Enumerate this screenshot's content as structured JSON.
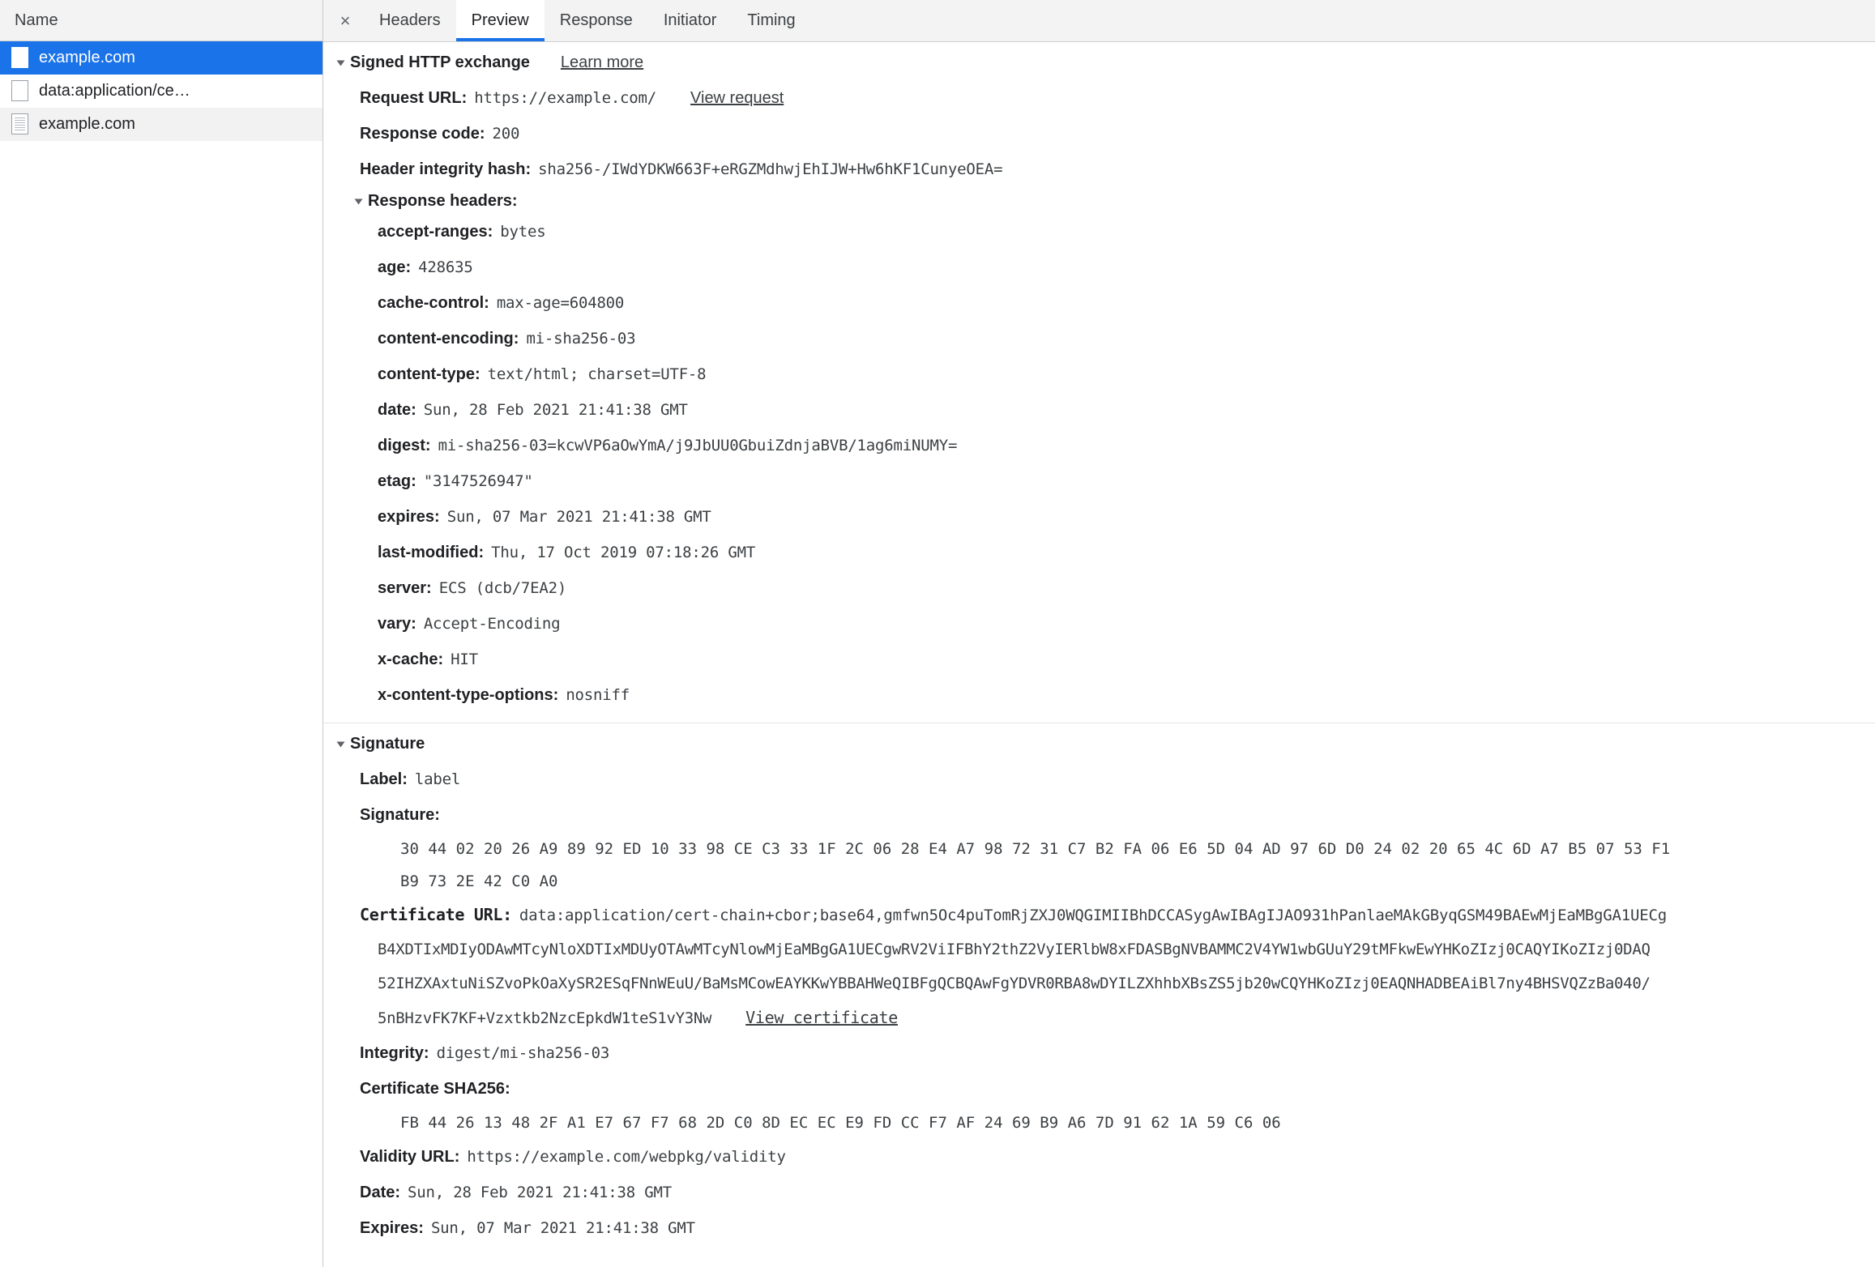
{
  "request_list": {
    "column_header": "Name",
    "items": [
      {
        "label": "example.com",
        "icon": "document-icon",
        "selected": true,
        "striped": false,
        "lined": false
      },
      {
        "label": "data:application/ce…",
        "icon": "document-icon",
        "selected": false,
        "striped": false,
        "lined": false
      },
      {
        "label": "example.com",
        "icon": "document-icon",
        "selected": false,
        "striped": true,
        "lined": true
      }
    ]
  },
  "tabs": {
    "close_label": "×",
    "items": [
      {
        "label": "Headers",
        "active": false
      },
      {
        "label": "Preview",
        "active": true
      },
      {
        "label": "Response",
        "active": false
      },
      {
        "label": "Initiator",
        "active": false
      },
      {
        "label": "Timing",
        "active": false
      }
    ]
  },
  "sxg": {
    "title": "Signed HTTP exchange",
    "learn_more": "Learn more",
    "request_url_key": "Request URL:",
    "request_url_value": "https://example.com/",
    "view_request": "View request",
    "response_code_key": "Response code:",
    "response_code_value": "200",
    "header_integrity_key": "Header integrity hash:",
    "header_integrity_value": "sha256-/IWdYDKW663F+eRGZMdhwjEhIJW+Hw6hKF1CunyeOEA=",
    "response_headers_title": "Response headers:",
    "response_headers": [
      {
        "name": "accept-ranges:",
        "value": "bytes"
      },
      {
        "name": "age:",
        "value": "428635"
      },
      {
        "name": "cache-control:",
        "value": "max-age=604800"
      },
      {
        "name": "content-encoding:",
        "value": "mi-sha256-03"
      },
      {
        "name": "content-type:",
        "value": "text/html; charset=UTF-8"
      },
      {
        "name": "date:",
        "value": "Sun, 28 Feb 2021 21:41:38 GMT"
      },
      {
        "name": "digest:",
        "value": "mi-sha256-03=kcwVP6aOwYmA/j9JbUU0GbuiZdnjaBVB/1ag6miNUMY="
      },
      {
        "name": "etag:",
        "value": "\"3147526947\""
      },
      {
        "name": "expires:",
        "value": "Sun, 07 Mar 2021 21:41:38 GMT"
      },
      {
        "name": "last-modified:",
        "value": "Thu, 17 Oct 2019 07:18:26 GMT"
      },
      {
        "name": "server:",
        "value": "ECS (dcb/7EA2)"
      },
      {
        "name": "vary:",
        "value": "Accept-Encoding"
      },
      {
        "name": "x-cache:",
        "value": "HIT"
      },
      {
        "name": "x-content-type-options:",
        "value": "nosniff"
      }
    ]
  },
  "signature": {
    "title": "Signature",
    "label_key": "Label:",
    "label_value": "label",
    "signature_key": "Signature:",
    "signature_bytes_line1": "30 44 02 20 26 A9 89 92 ED 10 33 98 CE C3 33 1F 2C 06 28 E4 A7 98 72 31 C7 B2 FA 06 E6 5D 04 AD 97 6D D0 24 02 20 65 4C 6D A7 B5 07 53 F1",
    "signature_bytes_line2": "B9 73 2E 42 C0 A0",
    "certificate_url_key": "Certificate URL:",
    "certificate_url_lines": [
      "data:application/cert-chain+cbor;base64,gmfwn5Oc4puTomRjZXJ0WQGIMIIBhDCCASygAwIBAgIJAO931hPanlaeMAkGByqGSM49BAEwMjEaMBgGA1UECg",
      "B4XDTIxMDIyODAwMTcyNloXDTIxMDUyOTAwMTcyNlowMjEaMBgGA1UECgwRV2ViIFBhY2thZ2VyIERlbW8xFDASBgNVBAMMC2V4YW1wbGUuY29tMFkwEwYHKoZIzj0CAQYIKoZIzj0DAQ",
      "52IHZXAxtuNiSZvoPkOaXySR2ESqFNnWEuU/BaMsMCowEAYKKwYBBAHWeQIBFgQCBQAwFgYDVR0RBA8wDYILZXhhbXBsZS5jb20wCQYHKoZIzj0EAQNHADBEAiBl7ny4BHSVQZzBa040/",
      "5nBHzvFK7KF+Vzxtkb2NzcEpkdW1teS1vY3Nw"
    ],
    "view_certificate": "View certificate",
    "integrity_key": "Integrity:",
    "integrity_value": "digest/mi-sha256-03",
    "cert_sha256_key": "Certificate SHA256:",
    "cert_sha256_bytes": "FB 44 26 13 48 2F A1 E7 67 F7 68 2D C0 8D EC EC E9 FD CC F7 AF 24 69 B9 A6 7D 91 62 1A 59 C6 06",
    "validity_url_key": "Validity URL:",
    "validity_url_value": "https://example.com/webpkg/validity",
    "date_key": "Date:",
    "date_value": "Sun, 28 Feb 2021 21:41:38 GMT",
    "expires_key": "Expires:",
    "expires_value": "Sun, 07 Mar 2021 21:41:38 GMT"
  },
  "colors": {
    "accent": "#1a73e8",
    "header_bg": "#f3f3f3",
    "text": "#202124",
    "mono_text": "#3c4043"
  }
}
